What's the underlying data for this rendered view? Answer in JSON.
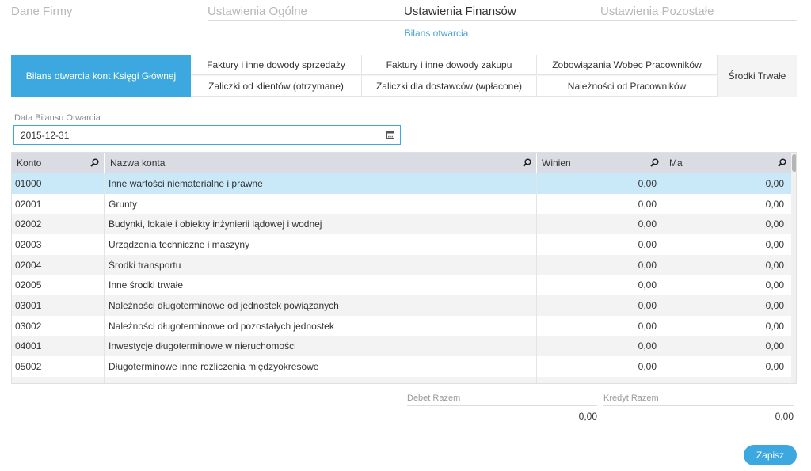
{
  "nav": {
    "tabs": [
      {
        "label": "Dane Firmy"
      },
      {
        "label": "Ustawienia Ogólne"
      },
      {
        "label": "Ustawienia Finansów"
      },
      {
        "label": "Ustawienia Pozostałe"
      }
    ],
    "subtitle": "Bilans otwarcia"
  },
  "sections": {
    "main": "Bilans otwarcia kont Księgi Głównej",
    "items": [
      "Faktury i inne dowody sprzedaży",
      "Faktury i inne dowody zakupu",
      "Zobowiązania Wobec Pracowników",
      "Zaliczki od klientów (otrzymane)",
      "Zaliczki dla dostawców (wpłacone)",
      "Należności od Pracowników"
    ],
    "last": "Środki Trwałe"
  },
  "date": {
    "label": "Data Bilansu Otwarcia",
    "value": "2015-12-31"
  },
  "table": {
    "columns": [
      "Konto",
      "Nazwa konta",
      "Winien",
      "Ma"
    ],
    "rows": [
      [
        "01000",
        "Inne wartości niematerialne i prawne",
        "0,00",
        "0,00"
      ],
      [
        "02001",
        "Grunty",
        "0,00",
        "0,00"
      ],
      [
        "02002",
        "Budynki, lokale i obiekty inżynierii lądowej i wodnej",
        "0,00",
        "0,00"
      ],
      [
        "02003",
        "Urządzenia techniczne i maszyny",
        "0,00",
        "0,00"
      ],
      [
        "02004",
        "Środki transportu",
        "0,00",
        "0,00"
      ],
      [
        "02005",
        "Inne środki trwałe",
        "0,00",
        "0,00"
      ],
      [
        "03001",
        "Należności długoterminowe od jednostek powiązanych",
        "0,00",
        "0,00"
      ],
      [
        "03002",
        "Należności długoterminowe od pozostałych jednostek",
        "0,00",
        "0,00"
      ],
      [
        "04001",
        "Inwestycje długoterminowe w nieruchomości",
        "0,00",
        "0,00"
      ],
      [
        "05002",
        "Długoterminowe inne rozliczenia międzyokresowe",
        "0,00",
        "0,00"
      ]
    ]
  },
  "totals": {
    "debit_label": "Debet Razem",
    "debit_value": "0,00",
    "credit_label": "Kredyt Razem",
    "credit_value": "0,00"
  },
  "actions": {
    "save": "Zapisz"
  },
  "colors": {
    "accent": "#3da8e0",
    "selected_row": "#c9e9f9"
  }
}
